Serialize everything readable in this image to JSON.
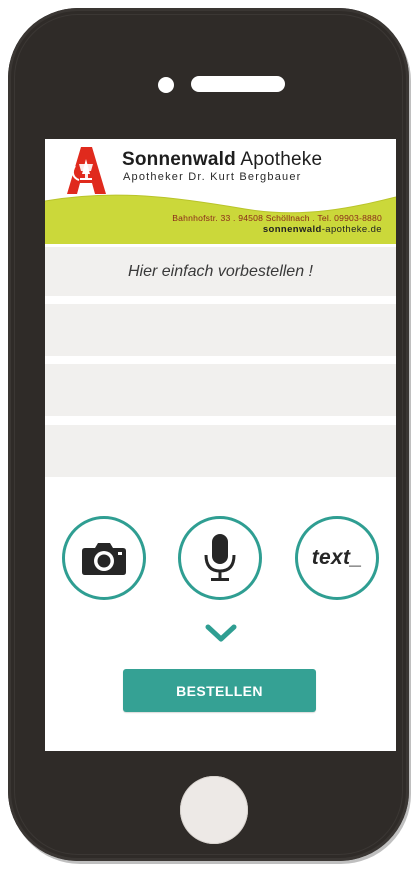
{
  "app": {
    "brand_bold": "Sonnenwald",
    "brand_light": "Apotheke",
    "subtitle": "Apotheker Dr. Kurt Bergbauer",
    "address": "Bahnhofstr. 33 . 94508 Schöllnach . Tel. 09903-8880",
    "website_bold": "sonnenwald",
    "website_rest": "-apotheke.de"
  },
  "form": {
    "intro": "Hier einfach vorbestellen !",
    "fields": [
      "",
      "",
      ""
    ]
  },
  "actions": {
    "camera_icon": "camera-icon",
    "microphone_icon": "microphone-icon",
    "text_label": "text_",
    "expand_icon": "chevron-down-icon",
    "submit_label": "BESTELLEN"
  },
  "colors": {
    "accent": "#35a194",
    "ring": "#2f9e92",
    "brand_red": "#e02a1d",
    "banner_green": "#cbd83a",
    "phone_body": "#2f2b28"
  }
}
